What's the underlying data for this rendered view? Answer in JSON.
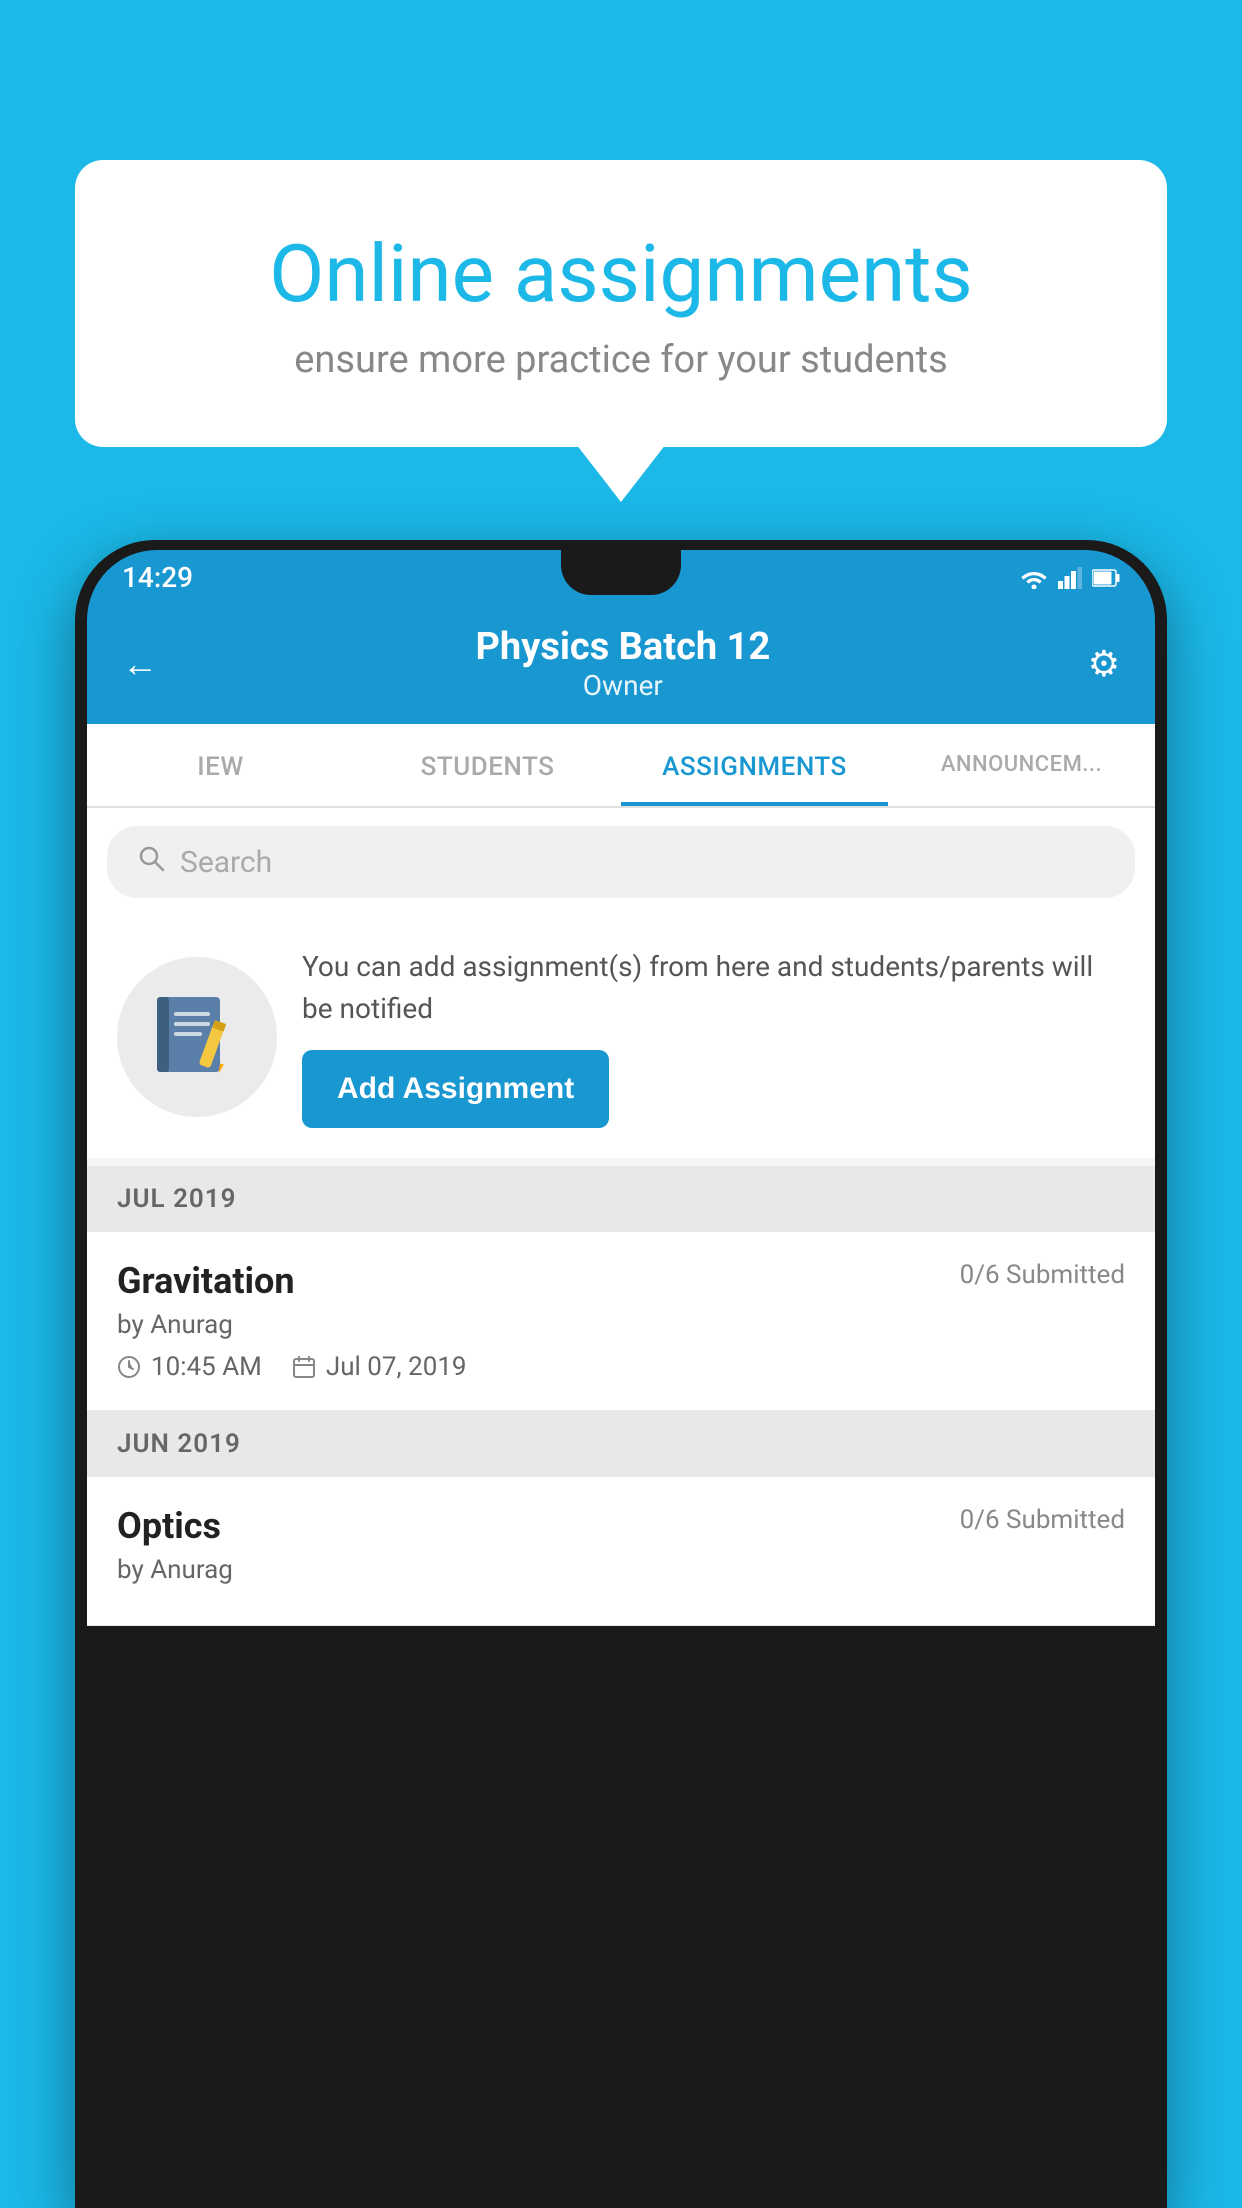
{
  "background": {
    "color": "#1bb8e8"
  },
  "speechBubble": {
    "title": "Online assignments",
    "subtitle": "ensure more practice for your students"
  },
  "statusBar": {
    "time": "14:29"
  },
  "header": {
    "title": "Physics Batch 12",
    "subtitle": "Owner"
  },
  "tabs": [
    {
      "label": "IEW",
      "active": false
    },
    {
      "label": "STUDENTS",
      "active": false
    },
    {
      "label": "ASSIGNMENTS",
      "active": true
    },
    {
      "label": "ANNOUNCEM...",
      "active": false
    }
  ],
  "search": {
    "placeholder": "Search"
  },
  "promoSection": {
    "description": "You can add assignment(s) from here and students/parents will be notified",
    "buttonLabel": "Add Assignment"
  },
  "months": [
    {
      "label": "JUL 2019",
      "assignments": [
        {
          "name": "Gravitation",
          "submitted": "0/6 Submitted",
          "by": "by Anurag",
          "time": "10:45 AM",
          "date": "Jul 07, 2019"
        }
      ]
    },
    {
      "label": "JUN 2019",
      "assignments": [
        {
          "name": "Optics",
          "submitted": "0/6 Submitted",
          "by": "by Anurag",
          "time": "",
          "date": ""
        }
      ]
    }
  ],
  "icons": {
    "back": "←",
    "gear": "⚙",
    "search": "🔍",
    "clock": "🕐",
    "calendar": "📅"
  }
}
